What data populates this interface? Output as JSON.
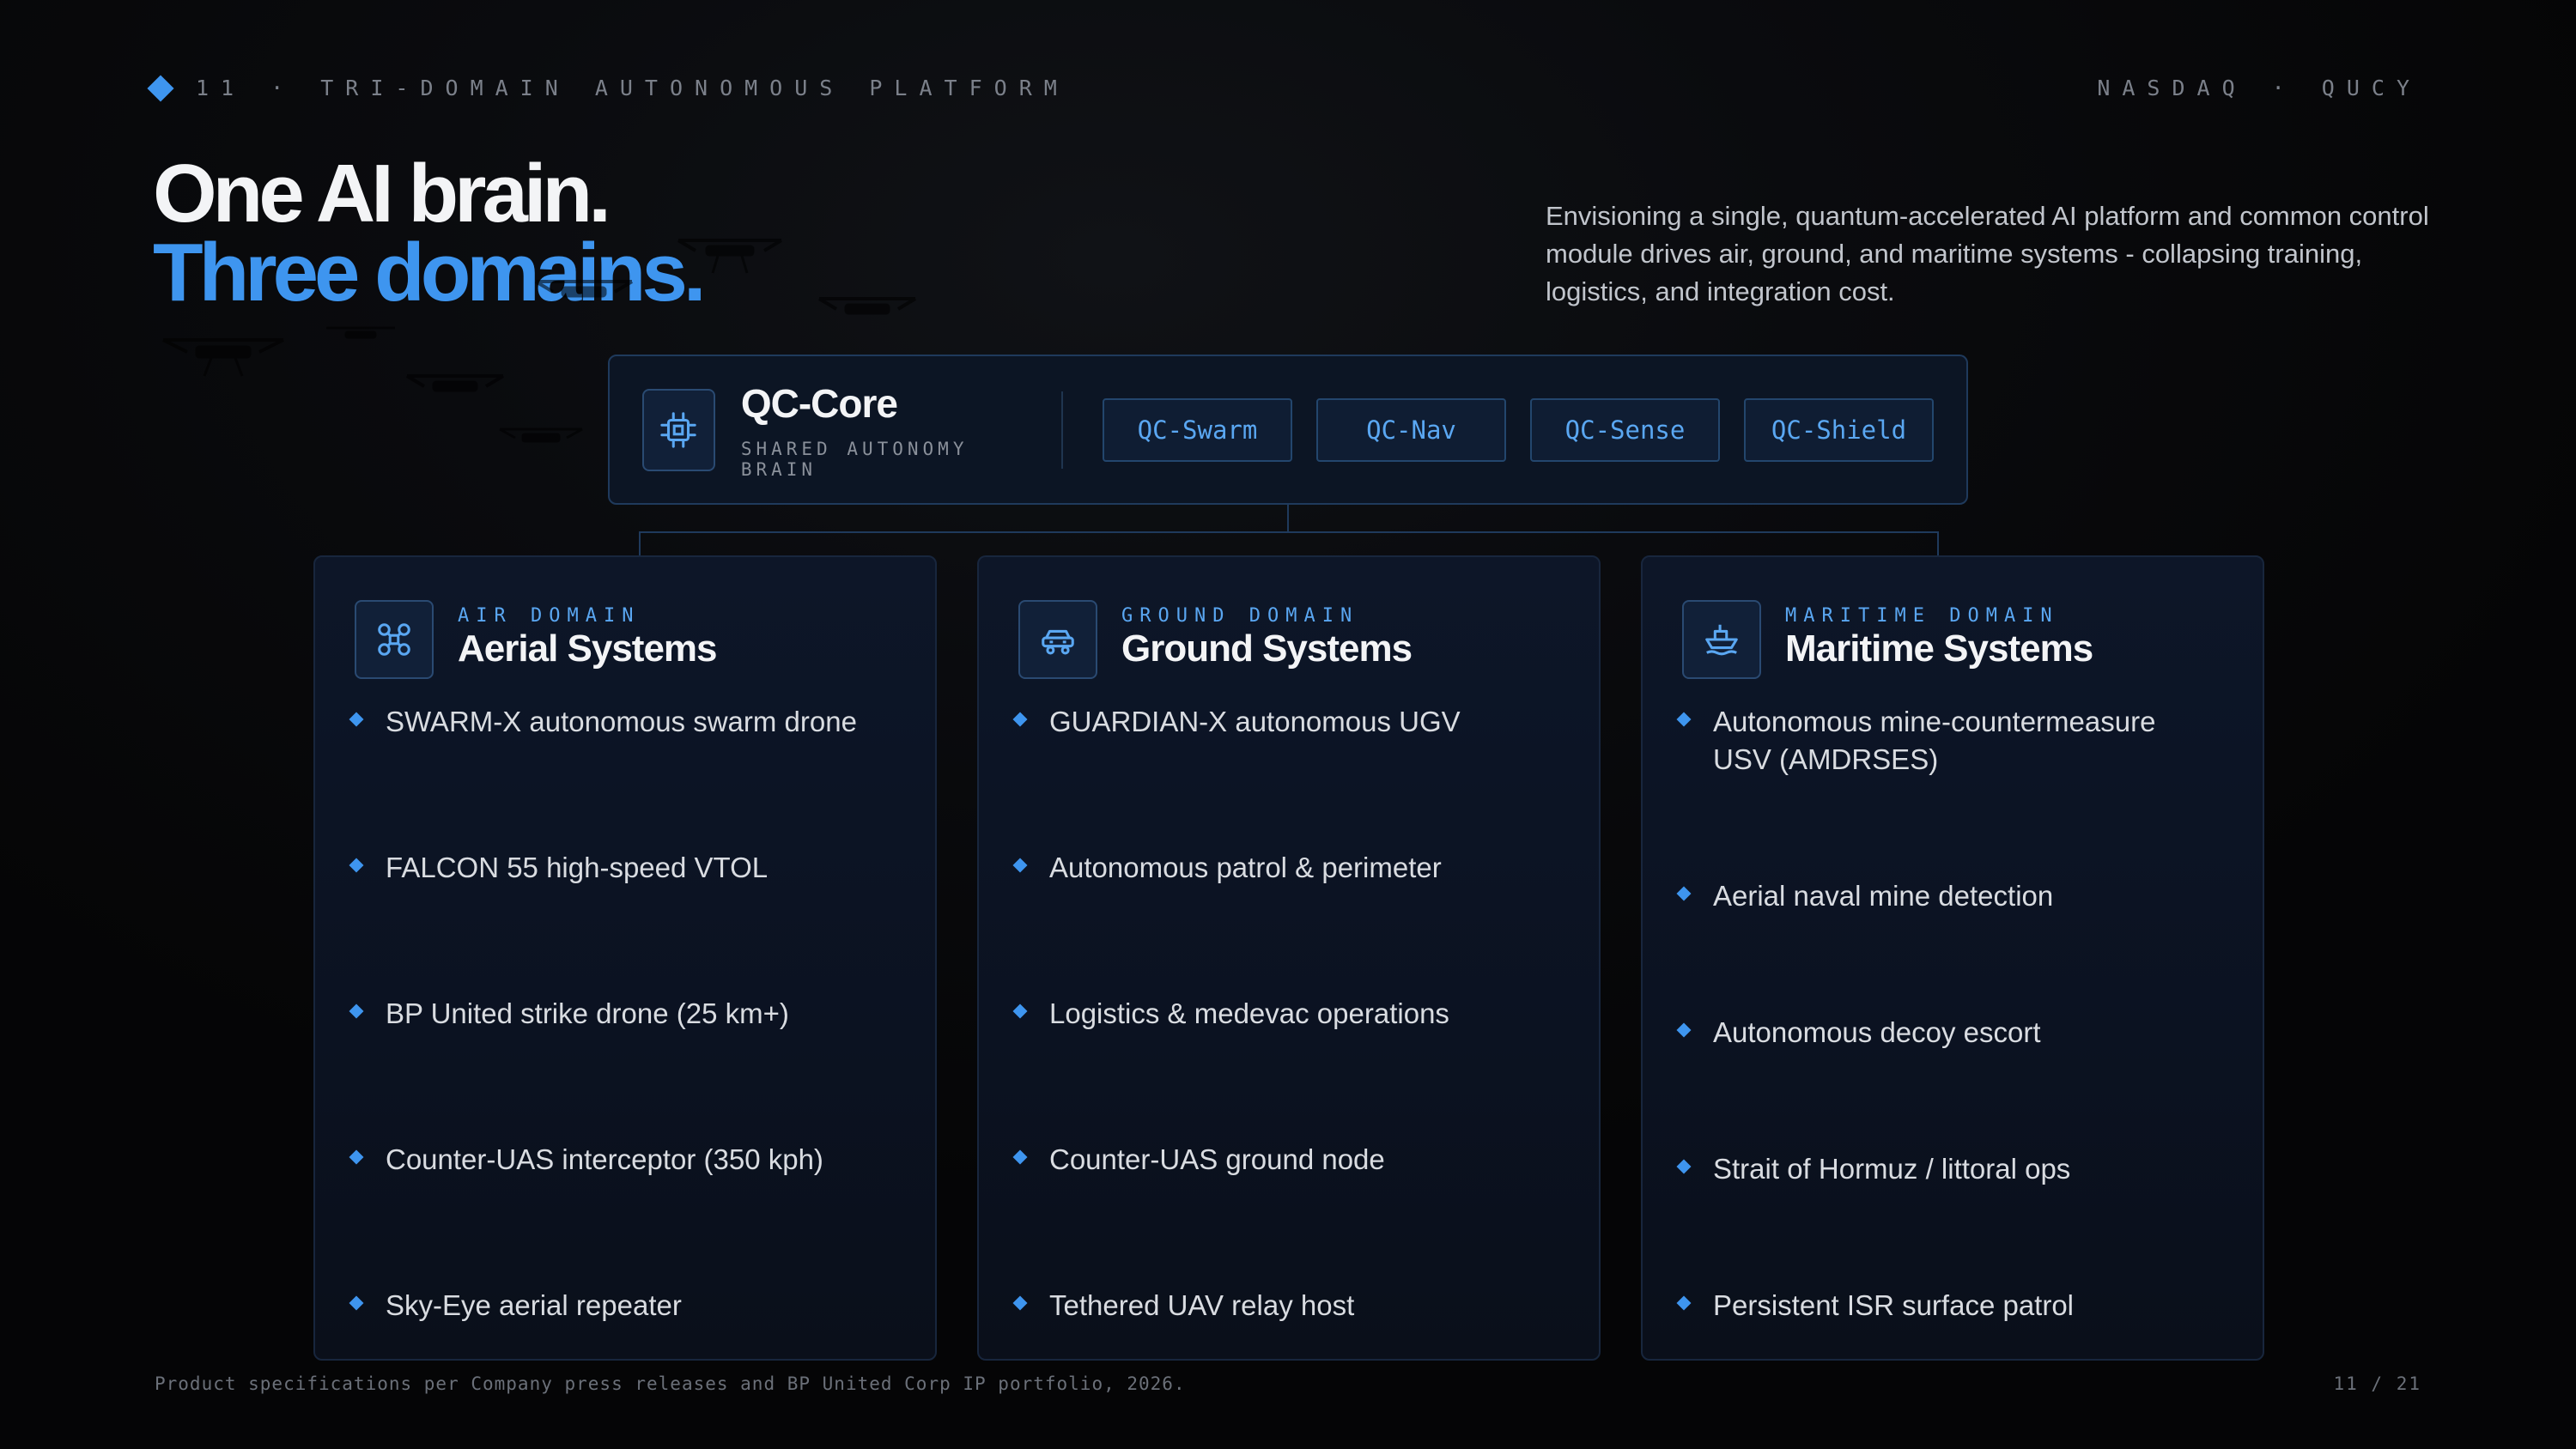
{
  "header": {
    "kicker": "11 · TRI-DOMAIN AUTONOMOUS PLATFORM",
    "ticker": "NASDAQ · QUCY"
  },
  "headline": {
    "line1": "One AI brain.",
    "line2": "Three domains."
  },
  "lede": "Envisioning a single, quantum-accelerated AI platform and common control module drives air, ground, and maritime systems - collapsing training, logistics, and integration cost.",
  "core": {
    "name": "QC-Core",
    "subtitle": "SHARED AUTONOMY BRAIN",
    "icon": "chip-icon",
    "modules": [
      "QC-Swarm",
      "QC-Nav",
      "QC-Sense",
      "QC-Shield"
    ]
  },
  "domains": [
    {
      "kicker": "AIR DOMAIN",
      "title": "Aerial Systems",
      "icon": "drone-icon",
      "items": [
        "SWARM-X autonomous swarm drone",
        "FALCON 55 high-speed VTOL",
        "BP United strike drone (25 km+)",
        "Counter-UAS interceptor (350 kph)",
        "Sky-Eye aerial repeater"
      ]
    },
    {
      "kicker": "GROUND DOMAIN",
      "title": "Ground Systems",
      "icon": "vehicle-icon",
      "items": [
        "GUARDIAN-X autonomous UGV",
        "Autonomous patrol & perimeter",
        "Logistics & medevac operations",
        "Counter-UAS ground node",
        "Tethered UAV relay host"
      ]
    },
    {
      "kicker": "MARITIME DOMAIN",
      "title": "Maritime Systems",
      "icon": "ship-icon",
      "items": [
        "Autonomous mine-countermeasure USV (AMDRSES)",
        "Aerial naval mine detection",
        "Autonomous decoy escort",
        "Strait of Hormuz / littoral ops",
        "Persistent ISR surface patrol"
      ]
    }
  ],
  "footer": {
    "note": "Product specifications per Company press releases and BP United Corp IP portfolio, 2026.",
    "pager": "11 / 21"
  },
  "colors": {
    "accent": "#3e95ef",
    "background": "#0a0b0e",
    "card": "#0c1524"
  }
}
